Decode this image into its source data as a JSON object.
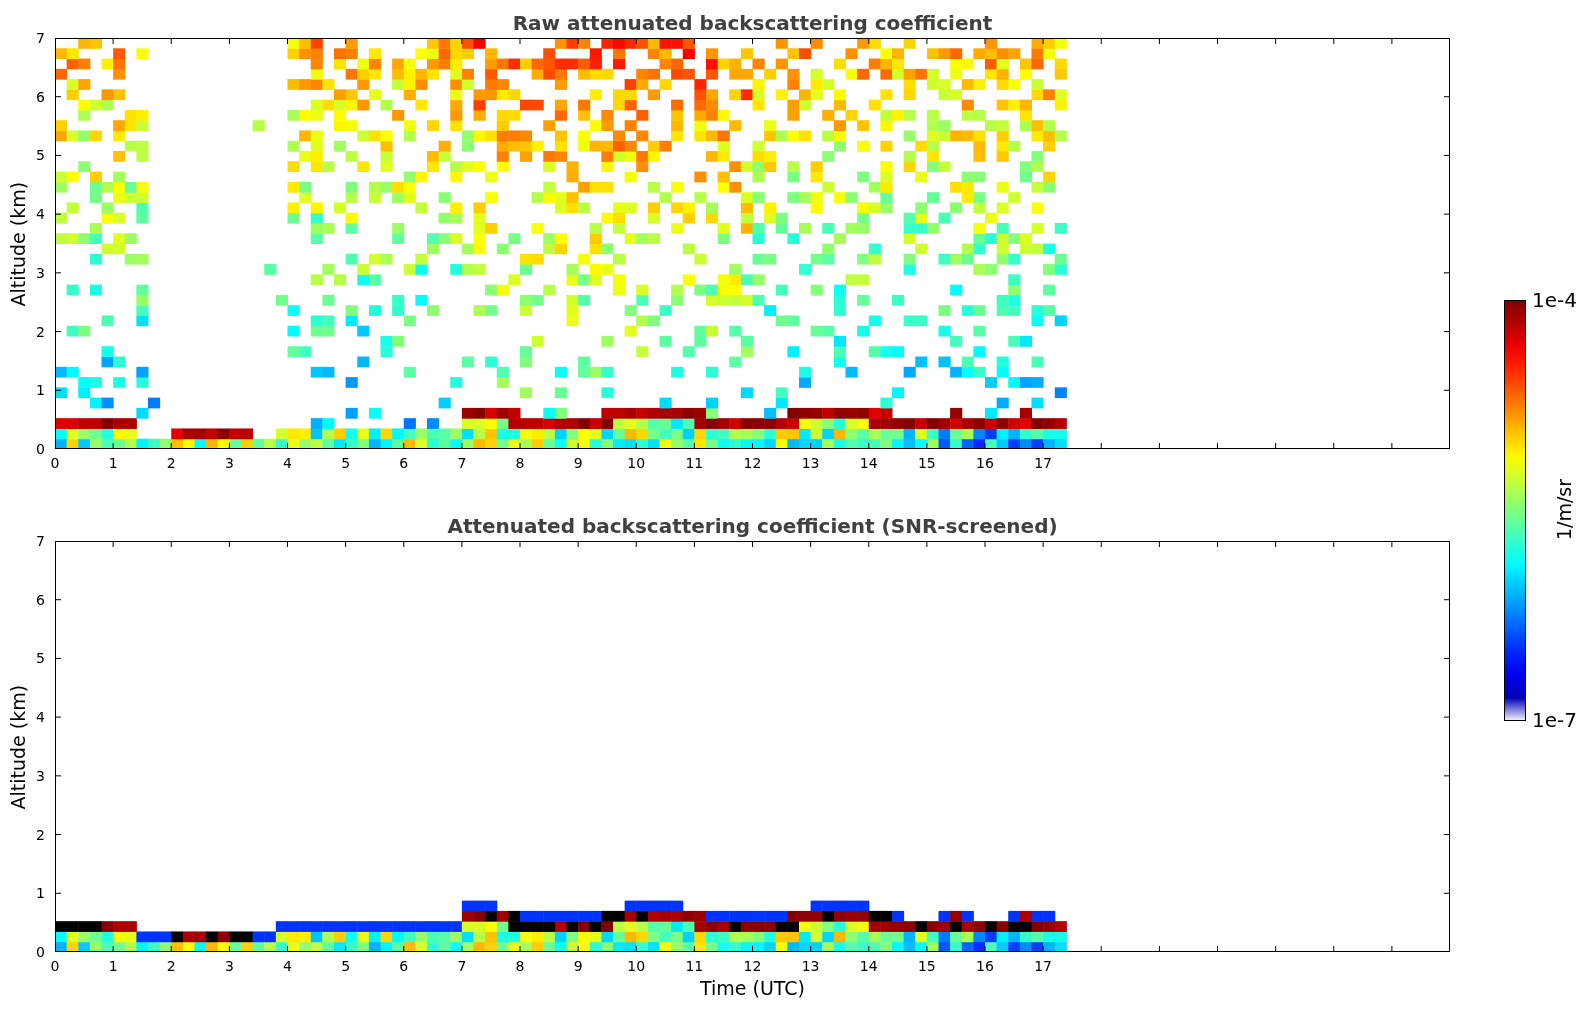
{
  "panels": [
    {
      "kind": "raw",
      "title": "Raw attenuated backscattering coefficient",
      "ylabel": "Altitude (km)",
      "yticks": [
        "7",
        "6",
        "5",
        "4",
        "3",
        "2",
        "1",
        "0"
      ],
      "xticks": [
        "0",
        "1",
        "2",
        "3",
        "4",
        "5",
        "6",
        "7",
        "8",
        "9",
        "10",
        "11",
        "12",
        "13",
        "14",
        "15",
        "16",
        "17"
      ]
    },
    {
      "kind": "screened",
      "title": "Attenuated backscattering coefficient (SNR-screened)",
      "ylabel": "Altitude (km)",
      "yticks": [
        "7",
        "6",
        "5",
        "4",
        "3",
        "2",
        "1",
        "0"
      ],
      "xticks": [
        "0",
        "1",
        "2",
        "3",
        "4",
        "5",
        "6",
        "7",
        "8",
        "9",
        "10",
        "11",
        "12",
        "13",
        "14",
        "15",
        "16",
        "17"
      ],
      "xlabel": "Time (UTC)"
    }
  ],
  "colorbar": {
    "max_label": "1e-4",
    "min_label": "1e-7",
    "label": "1/m/sr"
  }
}
